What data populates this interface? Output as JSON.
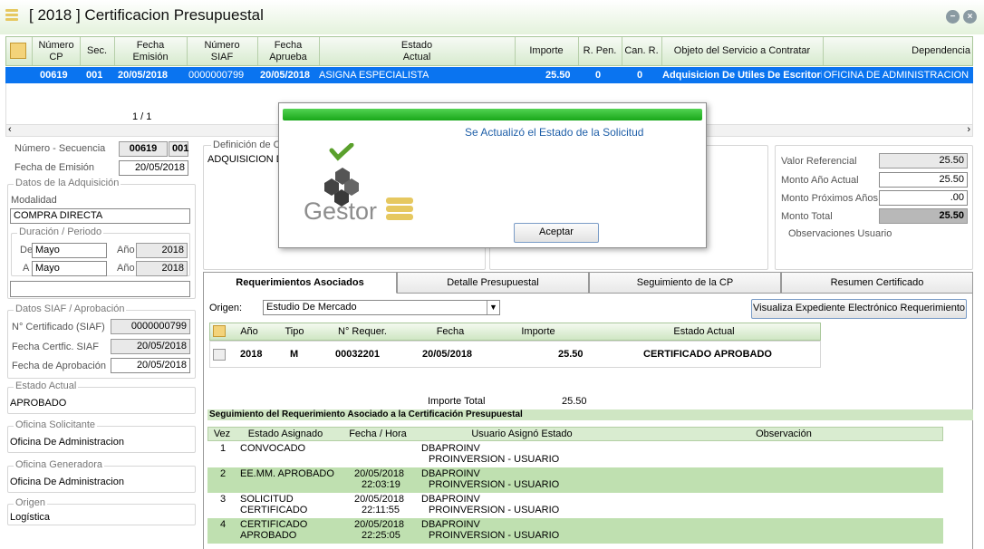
{
  "window": {
    "title": "[ 2018 ] Certificacion Presupuestal"
  },
  "grid": {
    "headers": [
      "Número\nCP",
      "Sec.",
      "Fecha\nEmisión",
      "Número\nSIAF",
      "Fecha\nAprueba",
      "Estado\nActual",
      "Importe",
      "R. Pen.",
      "Can. R.",
      "Objeto del Servicio a Contratar",
      "Dependencia"
    ],
    "row": {
      "cp": "00619",
      "sec": "001",
      "fecha_emision": "20/05/2018",
      "siaf": "0000000799",
      "fecha_aprueba": "20/05/2018",
      "estado": "ASIGNA ESPECIALISTA",
      "importe": "25.50",
      "r_pen": "0",
      "can_r": "0",
      "objeto": "Adquisicion De Utiles De Escritorio",
      "dependencia": "OFICINA DE ADMINISTRACION"
    },
    "pager": "1 / 1"
  },
  "left": {
    "numero_secuencia_label": "Número - Secuencia",
    "numero": "00619",
    "secuencia": "001",
    "fecha_emision_label": "Fecha de Emisión",
    "fecha_emision": "20/05/2018",
    "datos_adq_legend": "Datos de la Adquisición",
    "modalidad_label": "Modalidad",
    "modalidad": "COMPRA DIRECTA",
    "duracion_legend": "Duración / Periodo",
    "de_label": "De",
    "de_mes": "Mayo",
    "a_label": "A",
    "a_mes": "Mayo",
    "anio_label": "Año",
    "anio1": "2018",
    "anio2": "2018",
    "siaf_legend": "Datos SIAF / Aprobación",
    "cert_siaf_label": "N° Certificado (SIAF)",
    "cert_siaf": "0000000799",
    "fecha_cert_label": "Fecha Certfic. SIAF",
    "fecha_cert": "20/05/2018",
    "fecha_aprob_label": "Fecha de Aprobación",
    "fecha_aprob": "20/05/2018",
    "estado_legend": "Estado Actual",
    "estado": "APROBADO",
    "of_sol_legend": "Oficina Solicitante",
    "of_sol": "Oficina De Administracion",
    "of_gen_legend": "Oficina Generadora",
    "of_gen": "Oficina De Administracion",
    "origen_legend": "Origen",
    "origen": "Logística"
  },
  "center": {
    "definicion_legend": "Definición de C",
    "definicion": "ADQUISICION DE"
  },
  "right": {
    "valor_ref_label": "Valor Referencial",
    "valor_ref": "25.50",
    "monto_actual_label": "Monto Año Actual",
    "monto_actual": "25.50",
    "monto_prox_label": "Monto Próximos Años",
    "monto_prox": ".00",
    "monto_total_label": "Monto Total",
    "monto_total": "25.50",
    "obs_legend": "Observaciones Usuario"
  },
  "tabs": [
    "Requerimientos Asociados",
    "Detalle Presupuestal",
    "Seguimiento de la CP",
    "Resumen Certificado"
  ],
  "req": {
    "origen_label": "Origen:",
    "origen_value": "Estudio De Mercado",
    "expediente_button": "Visualiza Expediente Electrónico Requerimiento",
    "headers": [
      "Año",
      "Tipo",
      "N° Requer.",
      "Fecha",
      "Importe",
      "Estado Actual"
    ],
    "row": {
      "anio": "2018",
      "tipo": "M",
      "nro": "00032201",
      "fecha": "20/05/2018",
      "importe": "25.50",
      "estado": "CERTIFICADO APROBADO"
    },
    "total_label": "Importe Total",
    "total": "25.50"
  },
  "seguimiento": {
    "title": "Seguimiento del Requerimiento Asociado a la Certificación Presupuestal",
    "headers": [
      "Vez",
      "Estado Asignado",
      "Fecha / Hora",
      "Usuario Asignó Estado",
      "Observación"
    ],
    "rows": [
      {
        "vez": "1",
        "estado": "CONVOCADO",
        "fecha": "",
        "hora": "",
        "usuario": "DBAPROINV",
        "perfil": "PROINVERSION - USUARIO"
      },
      {
        "vez": "2",
        "estado": "EE.MM. APROBADO",
        "fecha": "20/05/2018",
        "hora": "22:03:19",
        "usuario": "DBAPROINV",
        "perfil": "PROINVERSION - USUARIO"
      },
      {
        "vez": "3",
        "estado": "SOLICITUD\nCERTIFICADO",
        "fecha": "20/05/2018",
        "hora": "22:11:55",
        "usuario": "DBAPROINV",
        "perfil": "PROINVERSION - USUARIO"
      },
      {
        "vez": "4",
        "estado": "CERTIFICADO\nAPROBADO",
        "fecha": "20/05/2018",
        "hora": "22:25:05",
        "usuario": "DBAPROINV",
        "perfil": "PROINVERSION - USUARIO"
      }
    ]
  },
  "dialog": {
    "message": "Se Actualizó el Estado de la Solicitud",
    "logo_text": "Gestor",
    "ok": "Aceptar"
  },
  "colors": {
    "selection": "#0a74f0",
    "accent_green": "#22aa22",
    "header_green": "#d8ebcf"
  }
}
